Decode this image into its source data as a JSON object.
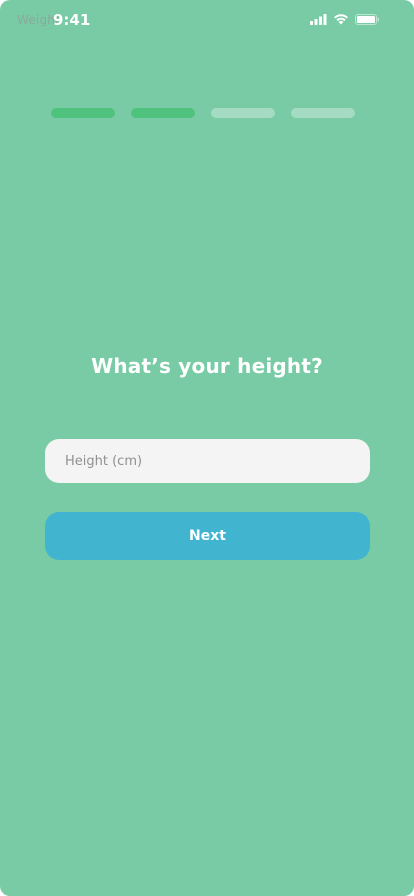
{
  "app": {
    "window_label": "Weight"
  },
  "status_bar": {
    "time": "9:41",
    "icons": [
      "cellular-signal-icon",
      "wifi-icon",
      "battery-icon"
    ]
  },
  "progress": {
    "steps_total": 4,
    "steps_completed": 2,
    "active_color": "#4fc27d"
  },
  "main": {
    "title": "What’s your height?",
    "height_input": {
      "value": "",
      "placeholder": "Height (cm)"
    },
    "next_button_label": "Next"
  },
  "colors": {
    "background": "#79cba5",
    "input_background": "#f4f4f4",
    "button": "#41b5d0",
    "text_on_color": "#ffffff"
  }
}
